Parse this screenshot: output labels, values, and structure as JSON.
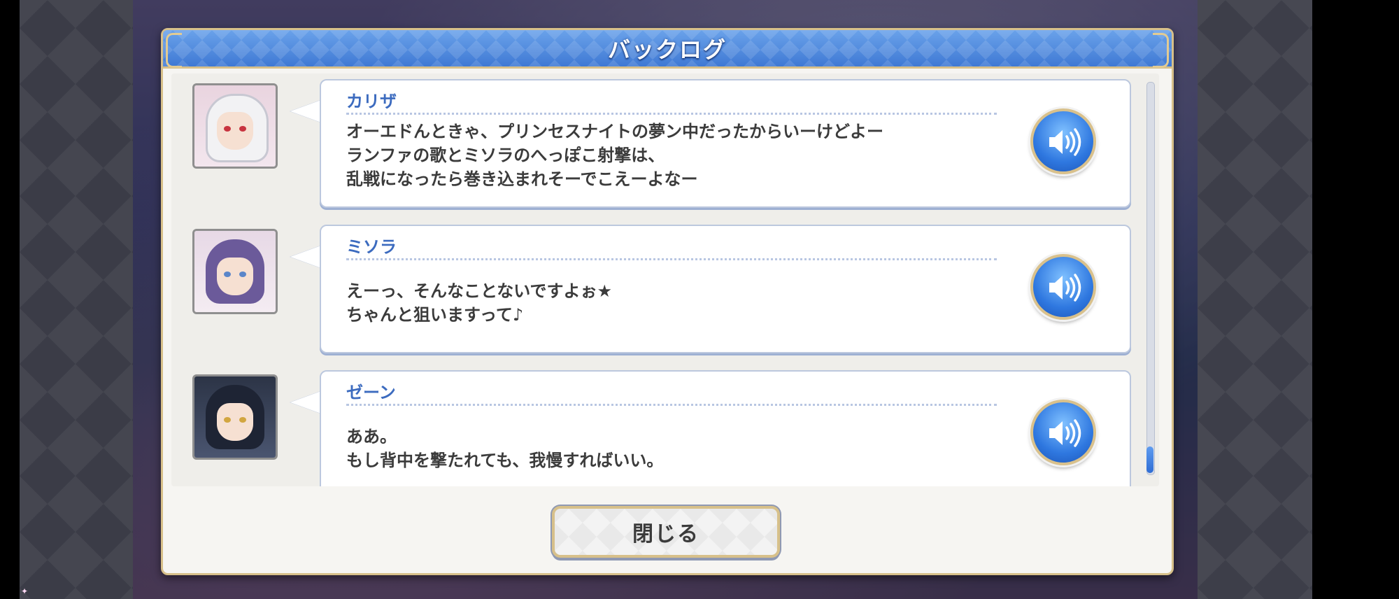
{
  "dialog": {
    "title": "バックログ",
    "close_label": "閉じる"
  },
  "entries": [
    {
      "speaker": "カリザ",
      "lines": [
        "オーエドんときゃ、プリンセスナイトの夢ン中だったからいーけどよー",
        "ランファの歌とミソラのへっぽこ射撃は、",
        "乱戦になったら巻き込まれそーでこえーよなー"
      ]
    },
    {
      "speaker": "ミソラ",
      "lines": [
        "えーっ、そんなことないですよぉ★",
        "ちゃんと狙いますって♪"
      ]
    },
    {
      "speaker": "ゼーン",
      "lines": [
        "ああ。",
        "もし背中を撃たれても、我慢すればいい。"
      ]
    }
  ],
  "scroll": {
    "position": 0.95
  },
  "colors": {
    "header_blue": "#4a86dc",
    "speaker_blue": "#3c6bbf",
    "gold_border": "#d7c08a",
    "voice_button": "#2f78e0"
  },
  "icons": {
    "voice": "speaker-volume-icon"
  }
}
